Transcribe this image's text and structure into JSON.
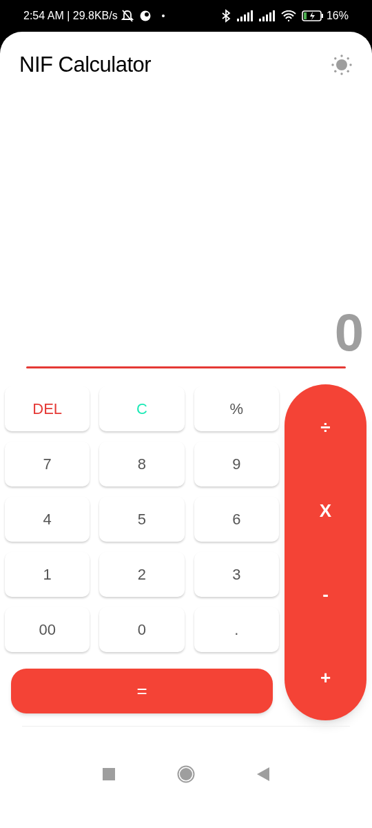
{
  "status_bar": {
    "time_speed": "2:54 AM | 29.8KB/s",
    "battery": "16%"
  },
  "app_bar": {
    "title": "NIF Calculator"
  },
  "display": {
    "value": "0"
  },
  "keys": [
    {
      "label": "DEL",
      "kind": "delete"
    },
    {
      "label": "C",
      "kind": "clear"
    },
    {
      "label": "%",
      "kind": "digit"
    },
    {
      "label": "7",
      "kind": "digit"
    },
    {
      "label": "8",
      "kind": "digit"
    },
    {
      "label": "9",
      "kind": "digit"
    },
    {
      "label": "4",
      "kind": "digit"
    },
    {
      "label": "5",
      "kind": "digit"
    },
    {
      "label": "6",
      "kind": "digit"
    },
    {
      "label": "1",
      "kind": "digit"
    },
    {
      "label": "2",
      "kind": "digit"
    },
    {
      "label": "3",
      "kind": "digit"
    },
    {
      "label": "00",
      "kind": "digit"
    },
    {
      "label": "0",
      "kind": "digit"
    },
    {
      "label": ".",
      "kind": "digit"
    }
  ],
  "operators": [
    "÷",
    "X",
    "-",
    "+"
  ],
  "equals": "="
}
